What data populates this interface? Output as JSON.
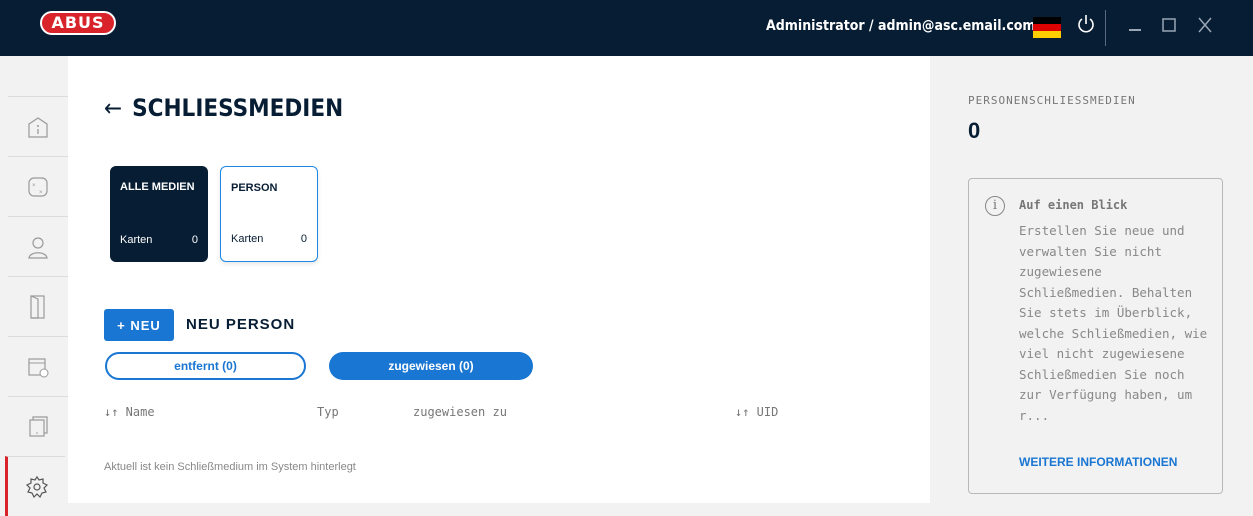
{
  "header": {
    "logo": "ABUS",
    "user": "Administrator / admin@asc.email.com",
    "flag_colors": [
      "#000000",
      "#dd0000",
      "#ffce00"
    ],
    "icons": {
      "power": "power-icon",
      "minimize": "minimize-icon",
      "maximize": "maximize-icon",
      "close": "close-icon"
    }
  },
  "sidebar": {
    "items": [
      {
        "icon": "info-icon"
      },
      {
        "icon": "calculator-icon"
      },
      {
        "icon": "person-icon"
      },
      {
        "icon": "door-icon"
      },
      {
        "icon": "calendar-icon"
      },
      {
        "icon": "device-icon"
      },
      {
        "icon": "gear-icon",
        "active": true
      }
    ]
  },
  "page": {
    "back_arrow": "←",
    "title": "SCHLIESSMEDIEN"
  },
  "cards": [
    {
      "title": "ALLE MEDIEN",
      "count_label": "Karten",
      "count": "0"
    },
    {
      "title": "PERSON",
      "count_label": "Karten",
      "count": "0"
    }
  ],
  "actions": {
    "new_button": "+ NEU",
    "new_label": "NEU PERSON"
  },
  "toggles": {
    "removed": "entfernt (0)",
    "assigned": "zugewiesen (0)"
  },
  "table": {
    "columns": [
      "↓↑ Name",
      "Typ",
      "zugewiesen zu",
      "↓↑ UID"
    ],
    "empty_message": "Aktuell ist kein Schließmedium im System hinterlegt"
  },
  "right_panel": {
    "label": "PERSONENSCHLIESSMEDIEN",
    "value": "0",
    "info": {
      "icon_glyph": "i",
      "title": "Auf einen Blick",
      "body": "Erstellen Sie neue und verwalten Sie nicht zugewiesene Schließmedien. Behalten Sie stets im Überblick, welche Schließmedien, wie viel nicht zugewiesene Schließmedien Sie noch zur Verfügung haben, um r...",
      "link": "WEITERE INFORMATIONEN"
    }
  }
}
